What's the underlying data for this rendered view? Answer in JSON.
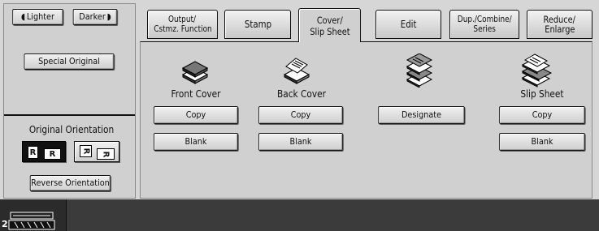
{
  "density": {
    "lighter_label": "Lighter",
    "darker_label": "Darker"
  },
  "left_panel": {
    "special_original_label": "Special Original",
    "original_orientation_label": "Original Orientation",
    "orientation_option_a": "R",
    "orientation_option_b": "R",
    "reverse_orientation_label": "Reverse Orientation"
  },
  "tabs": [
    {
      "line1": "Output/",
      "line2": "Cstmz. Function"
    },
    {
      "line1": "Stamp",
      "line2": ""
    },
    {
      "line1": "Cover/",
      "line2": "Slip Sheet"
    },
    {
      "line1": "Edit",
      "line2": ""
    },
    {
      "line1": "Dup./Combine/",
      "line2": "Series"
    },
    {
      "line1": "Reduce/",
      "line2": "Enlarge"
    }
  ],
  "active_tab": "Cover/ Slip Sheet",
  "front_cover": {
    "caption": "Front Cover",
    "copy_label": "Copy",
    "blank_label": "Blank"
  },
  "back_cover": {
    "caption": "Back Cover",
    "copy_label": "Copy",
    "blank_label": "Blank"
  },
  "designate": {
    "label": "Designate"
  },
  "slip_sheet": {
    "caption": "Slip Sheet",
    "copy_label": "Copy",
    "blank_label": "Blank"
  },
  "status": {
    "tray_number": "2"
  }
}
